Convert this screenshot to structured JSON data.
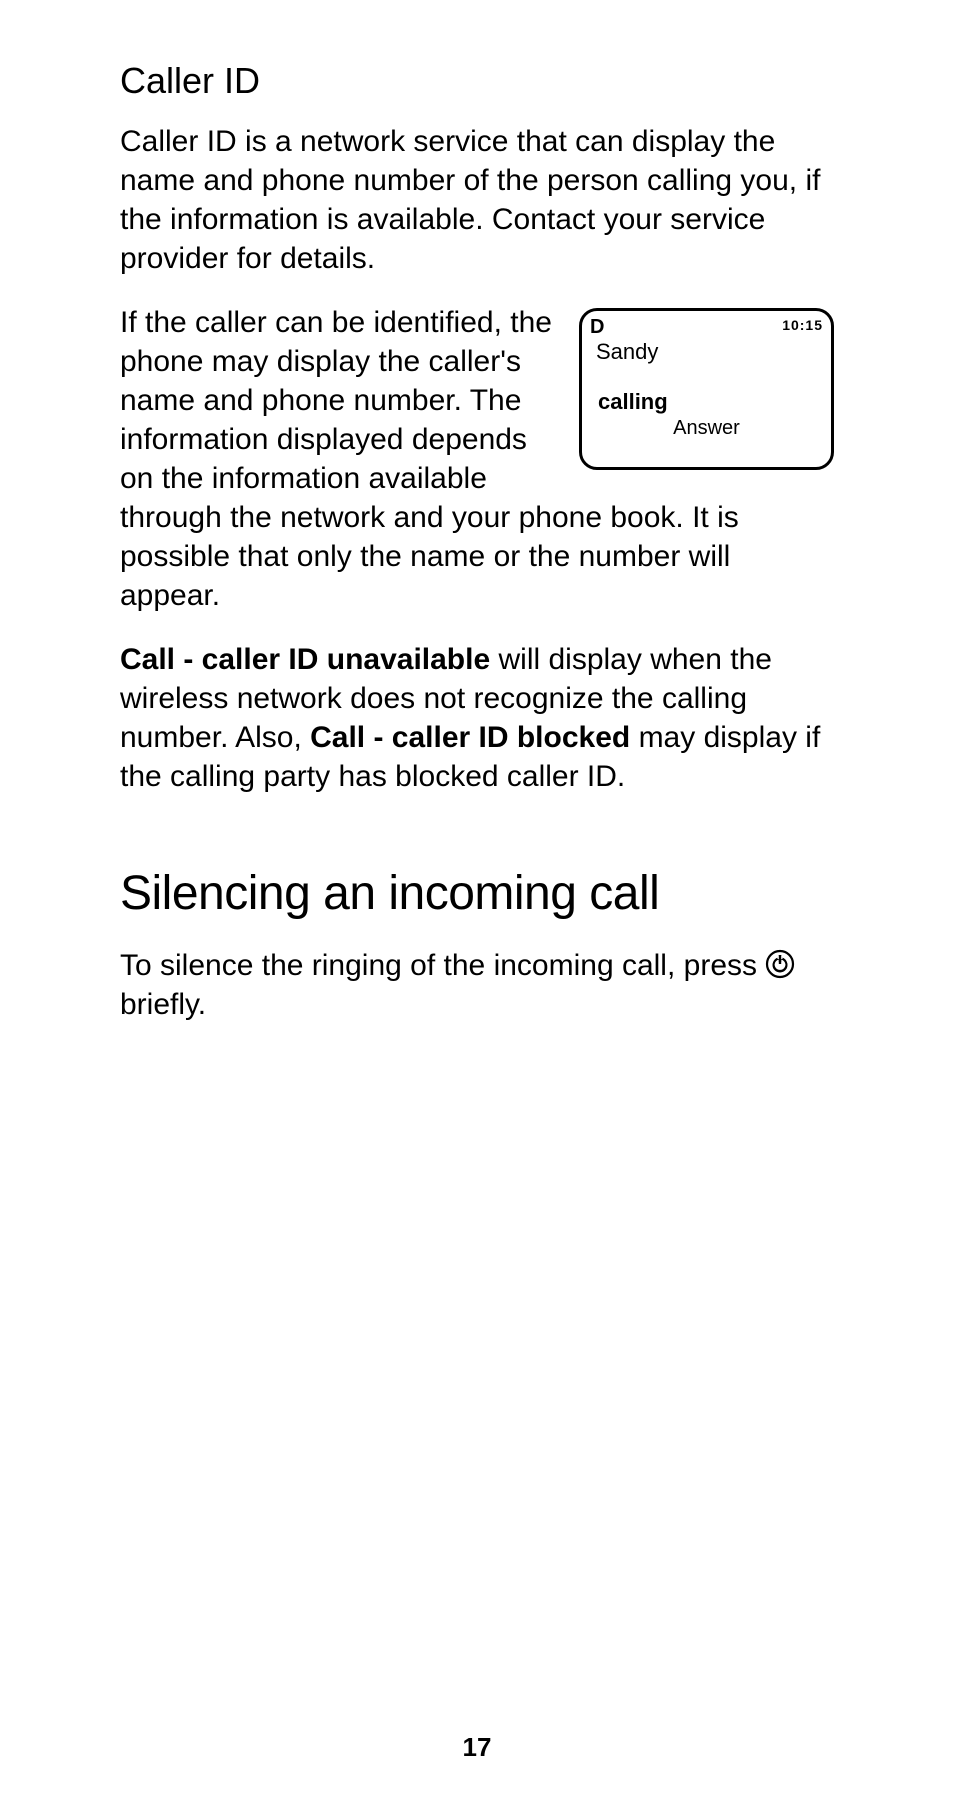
{
  "heading_caller_id": "Caller ID",
  "para1": "Caller ID is a network service that can display the name and phone number of the person calling you, if the information is available.  Contact your service provider for details.",
  "para2": "If the caller can be identified, the phone may display the caller's name and phone number. The information displayed depends on the information available through the network and your phone book. It is possible that only the name or the number will appear.",
  "para3_b1": "Call - caller ID unavailable",
  "para3_t1": " will display when the wireless network does not recognize the calling number. Also, ",
  "para3_b2": "Call - caller ID blocked",
  "para3_t2": " may display if the calling party has blocked caller ID.",
  "heading_silencing": "Silencing an incoming call",
  "para4_t1": "To silence the ringing of the incoming call, press ",
  "para4_t2": " briefly.",
  "phone": {
    "d_icon": "D",
    "time": "10:15",
    "name": "Sandy",
    "calling": "calling",
    "answer": "Answer"
  },
  "page_number": "17"
}
